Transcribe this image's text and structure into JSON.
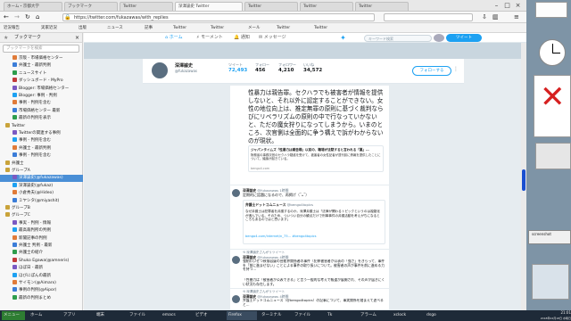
{
  "browser": {
    "tabs": [
      {
        "label": "ホーム・京都大学"
      },
      {
        "label": "ブックマーク"
      },
      {
        "label": "Twitter"
      },
      {
        "label": "深澤諭史 Twitter"
      },
      {
        "label": "Twitter"
      },
      {
        "label": "Twitter"
      },
      {
        "label": "Twitter"
      }
    ],
    "url": "https://twitter.com/fukazawas/with_replies",
    "bookmarks_bar": [
      "近況報告",
      "実家近況",
      "出版",
      "ニュース",
      "記事",
      "Twitter",
      "Twitter",
      "メール",
      "Twitter",
      "Twitter"
    ]
  },
  "sidebar": {
    "title": "ブックマーク",
    "search_placeholder": "ブックマークを検索",
    "items": [
      {
        "label": "京阪 - 市場価格センター"
      },
      {
        "label": "弁護士 - 最新判例"
      },
      {
        "label": "ニュースサイト"
      },
      {
        "label": "ダッシュボード - MyPro"
      },
      {
        "label": "Blogger: 市場価格センター"
      },
      {
        "label": "Blogger: 事例 - 判例"
      },
      {
        "label": "事例 - 判例を含む"
      },
      {
        "label": "市場価格センター 最新"
      },
      {
        "label": "最新の判例を表示"
      },
      {
        "label": "Twitter"
      },
      {
        "label": "Twitterの関連する事例"
      },
      {
        "label": "事例 - 判例を含む"
      },
      {
        "label": "弁護士 - 最新判例"
      },
      {
        "label": "事例 - 判例を含む"
      },
      {
        "label": "弁護士"
      },
      {
        "label": "グループA"
      },
      {
        "label": "深澤諭史(@fukazawas)"
      },
      {
        "label": "深澤諭史(@fukaz)"
      },
      {
        "label": "小倉秀夫(@Hideo)"
      },
      {
        "label": "ミヤシタ(@miyashit)"
      },
      {
        "label": "グループB"
      },
      {
        "label": "グループC"
      },
      {
        "label": "事実 - 判例 - 情報"
      },
      {
        "label": "最高裁判所の判例"
      },
      {
        "label": "新聞記事の判例"
      },
      {
        "label": "弁護士 判例 - 最新"
      },
      {
        "label": "弁護士の紹介"
      },
      {
        "label": "Shuko Egawa(@amneris)"
      },
      {
        "label": "ほぼ日 - 最新"
      },
      {
        "label": "ほびにぽんの最新"
      },
      {
        "label": "サイモン(@Aimarx)"
      },
      {
        "label": "事例の判例(@Aipor)"
      },
      {
        "label": "最新の判例まとめ"
      }
    ]
  },
  "twitter_nav": {
    "items": [
      "ホーム",
      "モーメント",
      "通知",
      "メッセージ"
    ],
    "search_placeholder": "キーワード検索",
    "tweet_button": "ツイート"
  },
  "profile": {
    "name": "深澤諭史",
    "handle": "@fukazawas",
    "stats": [
      {
        "label": "ツイート",
        "value": "72,493"
      },
      {
        "label": "フォロー",
        "value": "456"
      },
      {
        "label": "フォロワー",
        "value": "4,210"
      },
      {
        "label": "いいね",
        "value": "34,572"
      }
    ],
    "follow_button": "フォローする"
  },
  "tweets": [
    {
      "body": "性暴力は親告罪。セクハラでも被害者が情報を提供しないと、それ以外に認定することができない。女性の地位向上は、推定無罪の原則に基づく裁判ならびにリベラリズムの原則の中で行なっていかないと、ただの魔女狩りになってしまうから。いまのところ、次官側は全面的に争う構えで訴がわからないのが現状。",
      "link_title": "ジャパンタイムズ「性暴力は親告罪」以前の、職場が沈黙すると言われる「裏」…",
      "link_desc": "財務省の事務次官のセクハラ疑惑を受けて、被害者の女性記者が週刊誌に情報を提供したことについて、議論が起きている。",
      "link_domain": "bengo4.com"
    },
    {
      "name": "深澤諭史",
      "handle": "@fukazawas",
      "time": "1時間",
      "body": "定期的に話題になるので、再掲げ（˘ᴗ˘）",
      "sub_name": "弁護士ドットコムニュース",
      "sub_handle": "@bengo4topics",
      "sub_body": "なぜ弁護士は犯罪者を弁護するのか。深澤弁護士は「法律が関わるトピックというのは複雑化が進んでいる。そのため、ついつい自分の観点だけで刑事事件の弁護活動を考えがちになるところもあるのではと思います」",
      "sub_link": "bengo4.com/internet/n_75... #bengo4topics"
    },
    {
      "retweet_by": "深澤諭史さんがリツイート",
      "name": "深澤諭史",
      "handle": "@fukazawas",
      "time": "4時間",
      "body": "強制わいせつ致傷容疑の芸能界関係者の事件（犯罪被害者が公表の「強さ」をきらって、事件を「前に進ませない」ことによる事件の取り扱いについて。被害者の声が事件を前に進める力を持つ…",
      "body2": "「性暴力は「被害者が公表できる」と言う一般的な考えで報道が展開され、その声が届きにくい状況も存在します。"
    },
    {
      "retweet_by": "深澤諭史さんがリツイート",
      "name": "深澤諭史",
      "handle": "@fukazawas",
      "time": "4時間",
      "body": "弁護士ドットコムニュース（@bengo4topics）の記事について、事実関係を踏まえて述べると…"
    }
  ],
  "taskbar": {
    "start": "メニュー",
    "items": [
      "ホーム",
      "アプリ",
      "端末",
      "ファイル",
      "emacs",
      "ビデオ",
      "Firefox",
      "ターミナル",
      "ファイル",
      "Tk",
      "アラーム",
      "xclock",
      "dsgo"
    ],
    "time": "21:01",
    "date": "2018年04月18日 水曜日"
  },
  "desktop_widgets": {
    "note_label": "screenshot"
  },
  "colors": {
    "twitter_blue": "#1da1f2",
    "sidebar_select": "#4a8fd6",
    "taskbar_bg": "#1e2a38",
    "red_x": "#d62020"
  }
}
